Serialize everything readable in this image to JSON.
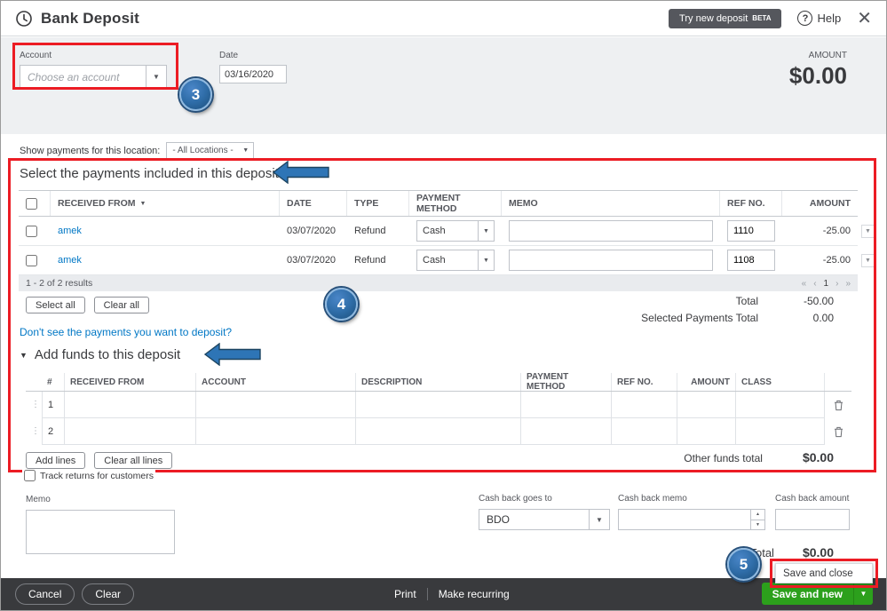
{
  "colors": {
    "brand_green": "#2ca01c",
    "link_blue": "#0077c5",
    "annotation_red": "#ec1c24",
    "annotation_blue": "#2e75b6",
    "footer_dark": "#393a3d"
  },
  "header": {
    "title": "Bank Deposit",
    "beta_button_label": "Try new deposit",
    "beta_tag": "BETA",
    "help_label": "Help"
  },
  "top_form": {
    "account_label": "Account",
    "account_placeholder": "Choose an account",
    "date_label": "Date",
    "date_value": "03/16/2020",
    "amount_label": "AMOUNT",
    "amount_value": "$0.00"
  },
  "location_filter": {
    "label": "Show payments for this location:",
    "value": "- All Locations -"
  },
  "payments": {
    "title": "Select the payments included in this deposit",
    "columns": {
      "received_from": "RECEIVED FROM",
      "date": "DATE",
      "type": "TYPE",
      "payment_method": "PAYMENT METHOD",
      "memo": "MEMO",
      "ref_no": "REF NO.",
      "amount": "AMOUNT"
    },
    "rows": [
      {
        "received_from": "amek",
        "date": "03/07/2020",
        "type": "Refund",
        "payment_method": "Cash",
        "ref_no": "1110",
        "amount": "-25.00"
      },
      {
        "received_from": "amek",
        "date": "03/07/2020",
        "type": "Refund",
        "payment_method": "Cash",
        "ref_no": "1108",
        "amount": "-25.00"
      }
    ],
    "results_text": "1 - 2 of 2 results",
    "pagination": {
      "first": "«",
      "prev": "‹",
      "page": "1",
      "next": "›",
      "last": "»"
    },
    "select_all_label": "Select all",
    "clear_all_label": "Clear all",
    "total_label": "Total",
    "total_value": "-50.00",
    "selected_total_label": "Selected Payments Total",
    "selected_total_value": "0.00",
    "dont_see_link": "Don't see the payments you want to deposit?"
  },
  "add_funds": {
    "title": "Add funds to this deposit",
    "columns": {
      "num": "#",
      "received_from": "RECEIVED FROM",
      "account": "ACCOUNT",
      "description": "DESCRIPTION",
      "payment_method": "PAYMENT METHOD",
      "ref_no": "REF NO.",
      "amount": "AMOUNT",
      "class": "CLASS"
    },
    "rows": [
      {
        "num": "1"
      },
      {
        "num": "2"
      }
    ],
    "add_lines_label": "Add lines",
    "clear_all_lines_label": "Clear all lines",
    "other_funds_label": "Other funds total",
    "other_funds_value": "$0.00"
  },
  "bottom": {
    "track_returns_label": "Track returns for customers",
    "memo_label": "Memo",
    "cash_back_goes_to_label": "Cash back goes to",
    "cash_back_goes_to_value": "BDO",
    "cash_back_memo_label": "Cash back memo",
    "cash_back_amount_label": "Cash back amount",
    "total_label": "Total",
    "total_value": "$0.00"
  },
  "footer": {
    "cancel_label": "Cancel",
    "clear_label": "Clear",
    "print_label": "Print",
    "make_recurring_label": "Make recurring",
    "save_and_close_label": "Save and close",
    "save_and_new_label": "Save and new"
  },
  "annotations": {
    "step_3": "3",
    "step_4": "4",
    "step_5": "5"
  }
}
